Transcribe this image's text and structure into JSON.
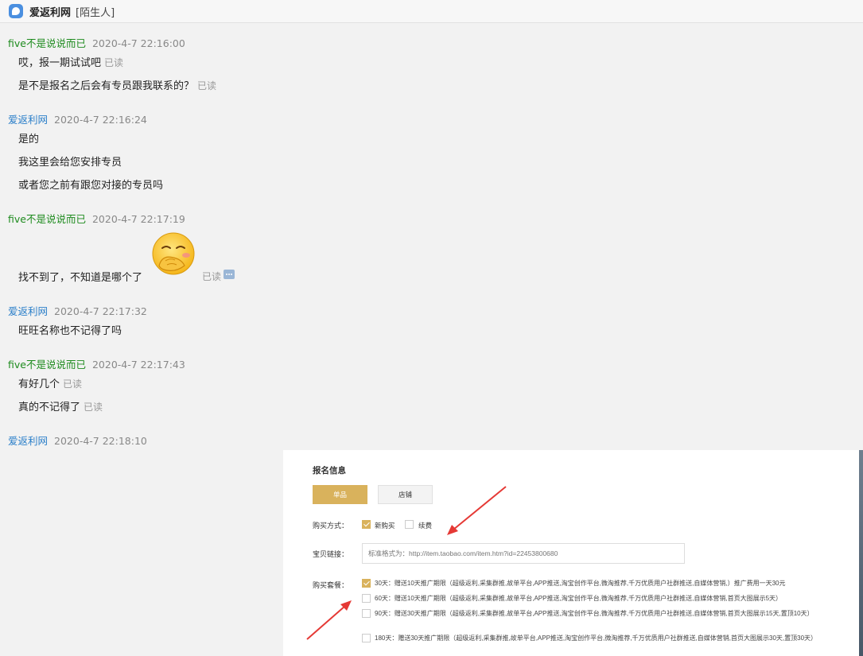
{
  "window": {
    "title": "爱返利网",
    "subtitle": "[陌生人]"
  },
  "chat": {
    "messages": [
      {
        "sender": "five不是说说而已",
        "time": "2020-4-7 22:16:00",
        "lines": [
          {
            "text": "哎，报一期试试吧",
            "status": "已读"
          },
          {
            "text": "是不是报名之后会有专员跟我联系的？",
            "status": "已读"
          }
        ]
      },
      {
        "sender": "爱返利网",
        "time": "2020-4-7 22:16:24",
        "lines": [
          {
            "text": "是的"
          },
          {
            "text": "我这里会给您安排专员"
          },
          {
            "text": "或者您之前有跟您对接的专员吗"
          }
        ]
      },
      {
        "sender": "five不是说说而已",
        "time": "2020-4-7 22:17:19",
        "lines": [
          {
            "text": "找不到了，不知道是哪个了",
            "status": "已读"
          }
        ]
      },
      {
        "sender": "爱返利网",
        "time": "2020-4-7 22:17:32",
        "lines": [
          {
            "text": "旺旺名称也不记得了吗"
          }
        ]
      },
      {
        "sender": "five不是说说而已",
        "time": "2020-4-7 22:17:43",
        "lines": [
          {
            "text": "有好几个",
            "status": "已读"
          },
          {
            "text": "真的不记得了",
            "status": "已读"
          }
        ]
      },
      {
        "sender": "爱返利网",
        "time": "2020-4-7 22:18:10",
        "lines": []
      }
    ]
  },
  "form": {
    "title": "报名信息",
    "tabs": [
      {
        "label": "单品",
        "active": true
      },
      {
        "label": "店铺",
        "active": false
      }
    ],
    "purchase_method": {
      "label": "购买方式：",
      "options": [
        {
          "label": "新购买",
          "checked": true
        },
        {
          "label": "续费",
          "checked": false
        }
      ]
    },
    "link": {
      "label": "宝贝链接：",
      "placeholder": "标准格式为：http://item.taobao.com/item.htm?id=22453800680"
    },
    "package": {
      "label": "购买套餐：",
      "options": [
        {
          "checked": true,
          "text": "30天：赠送10天推广期限（超级返利,采集群推,故单平台,APP推送,淘宝创作平台,微淘推荐,千万优质用户社群推送,自媒体营销,）推广费用一天30元"
        },
        {
          "checked": false,
          "text": "60天：赠送10天推广期限（超级返利,采集群推,故单平台,APP推送,淘宝创作平台,微淘推荐,千万优质用户社群推送,自媒体营销,首页大图展示5天）"
        },
        {
          "checked": false,
          "text": "90天：赠送30天推广期限（超级返利,采集群推,故单平台,APP推送,淘宝创作平台,微淘推荐,千万优质用户社群推送,自媒体营销,首页大图展示15天,置顶10天）"
        },
        {
          "checked": false,
          "text": "180天：赠送30天推广期限（超级返利,采集群推,故单平台,APP推送,淘宝创作平台,微淘推荐,千万优质用户社群推送,自媒体营销,首页大图展示30天,置顶30天）"
        }
      ]
    }
  },
  "colors": {
    "user_name": "#1e8b1e",
    "shop_name": "#2b7fc9",
    "accent_gold": "#d9b25c",
    "annotation_arrow": "#e53935"
  }
}
